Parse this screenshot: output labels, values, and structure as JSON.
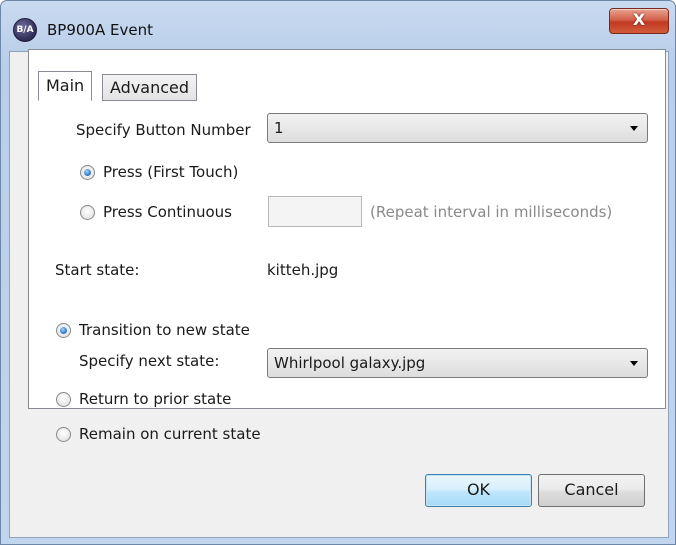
{
  "window": {
    "title": "BP900A Event",
    "app_icon_text": "B/A",
    "close_label": "X"
  },
  "tabs": [
    {
      "label": "Main",
      "selected": true
    },
    {
      "label": "Advanced",
      "selected": false
    }
  ],
  "main": {
    "button_number_label": "Specify Button Number",
    "button_number_value": "1",
    "press_first_touch_label": "Press (First Touch)",
    "press_first_touch_checked": true,
    "press_continuous_label": "Press Continuous",
    "press_continuous_checked": false,
    "repeat_interval_value": "",
    "repeat_interval_hint": "(Repeat interval in milliseconds)",
    "start_state_label": "Start state:",
    "start_state_value": "kitteh.jpg",
    "transition_label": "Transition to new state",
    "transition_checked": true,
    "next_state_label": "Specify next state:",
    "next_state_value": "Whirlpool galaxy.jpg",
    "return_prior_label": "Return to prior state",
    "remain_current_label": "Remain on current state"
  },
  "footer": {
    "ok_label": "OK",
    "cancel_label": "Cancel"
  }
}
